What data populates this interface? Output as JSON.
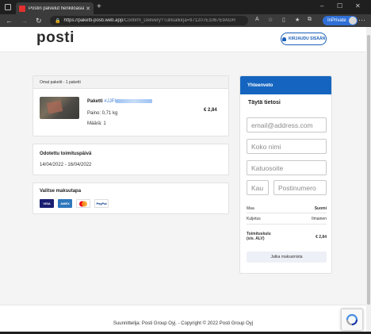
{
  "browser": {
    "tab_title": "Postin palvelut henkilöasiakkaille",
    "tab_close": "✕",
    "new_tab": "+",
    "url_host": "https://paketti-posti.web.app",
    "url_path": "/Confirm_Delivery?Tullisalkirja=971207E1067E9AGH",
    "inprivate_label": "InPrivate",
    "icons": [
      "back-icon",
      "forward-icon",
      "reload-icon",
      "lock-icon",
      "favorites-icon",
      "collections-icon",
      "more-icon"
    ]
  },
  "header": {
    "logo": "posti",
    "login_label": "KIRJAUDU SISÄÄN"
  },
  "shipment": {
    "header": "Omat paketit - 1 paketti",
    "package_prefix": "Paketti",
    "package_code": "#JJFI",
    "weight": "Paino: 0,71 kg",
    "quantity": "Määrä: 1",
    "price": "€ 2,84"
  },
  "delivery": {
    "title": "Odotettu toimituspäivä",
    "dates": "14/04/2022 - 16/04/2022"
  },
  "payment": {
    "title": "Valitse maksutapa",
    "methods": [
      {
        "label": "VISA",
        "color": "#1a1f71"
      },
      {
        "label": "AMEX",
        "color": "#2e77bc"
      },
      {
        "label": "MC",
        "color": "#eb001b"
      },
      {
        "label": "PayPal",
        "color": "#003087"
      }
    ]
  },
  "summary": {
    "title": "Yhteenveto",
    "form_title": "Täytä tietosi",
    "email_placeholder": "email@address.com",
    "name_placeholder": "Koko nimi",
    "street_placeholder": "Katuosoite",
    "city_placeholder": "Kau",
    "zip_placeholder": "Postinumero",
    "country_label": "Maa",
    "country_value": "Suomi",
    "shipping_label": "Kuljetus",
    "shipping_value": "Ilmainen",
    "total_label": "Toimituskulu",
    "total_sublabel": "(sis. ALV)",
    "total_value": "€ 2,84",
    "cta_label": "Jatka maksamista",
    "accent": "#1565c0"
  },
  "footer": {
    "text": "Suunnittelija: Posti Group Oyj. - Copyright © 2022 Posti Group Oyj"
  }
}
